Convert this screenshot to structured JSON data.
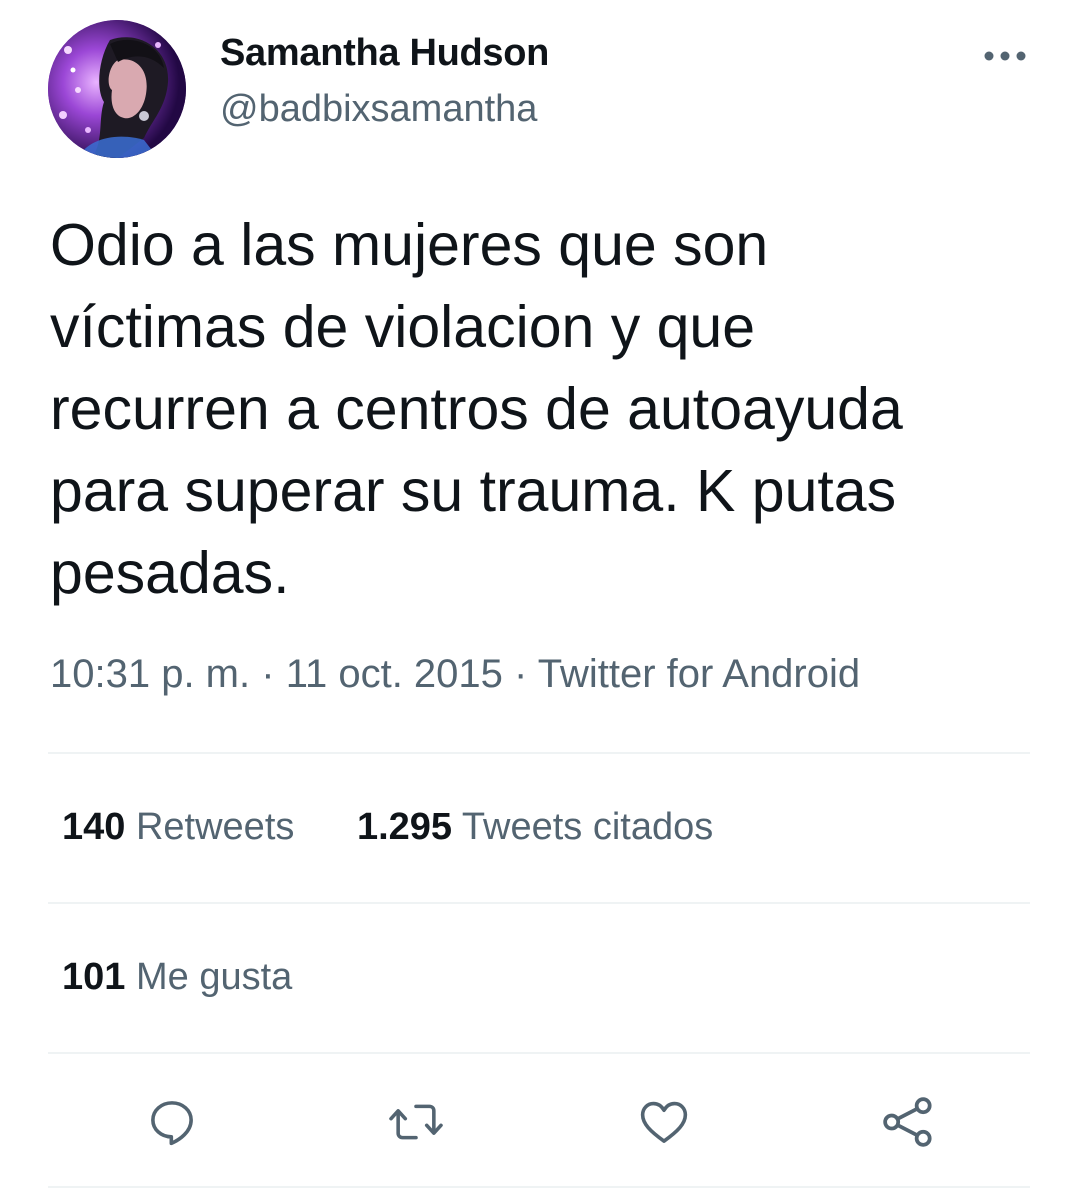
{
  "author": {
    "display_name": "Samantha Hudson",
    "handle": "@badbixsamantha",
    "avatar_icon": "profile-photo"
  },
  "tweet": {
    "text": "Odio a las mujeres que son\nvíctimas de violacion y que\nrecurren a centros de autoayuda\npara superar su trauma. K putas\npesadas.",
    "time": "10:31 p. m.",
    "separator": "·",
    "date": "11 oct. 2015",
    "source": "Twitter for Android"
  },
  "stats": {
    "retweets_count": "140",
    "retweets_label": "Retweets",
    "quotes_count": "1.295",
    "quotes_label": "Tweets citados",
    "likes_count": "101",
    "likes_label": "Me gusta"
  },
  "actions": {
    "reply_icon": "reply-icon",
    "retweet_icon": "retweet-icon",
    "like_icon": "heart-icon",
    "share_icon": "share-icon",
    "more_icon": "more-icon"
  },
  "colors": {
    "text": "#0f1419",
    "secondary": "#536471",
    "divider": "#eff3f4"
  }
}
